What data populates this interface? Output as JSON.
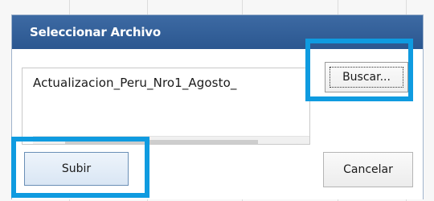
{
  "dialog": {
    "title": "Seleccionar Archivo",
    "file_name": "Actualizacion_Peru_Nro1_Agosto_",
    "browse_label": "Buscar...",
    "upload_label": "Subir",
    "cancel_label": "Cancelar"
  },
  "colors": {
    "titlebar": "#2f5d96",
    "highlight": "#0f9be0"
  },
  "icons": {
    "scroll_left": "scroll-left-arrow-icon",
    "scroll_right": "scroll-right-arrow-icon"
  }
}
